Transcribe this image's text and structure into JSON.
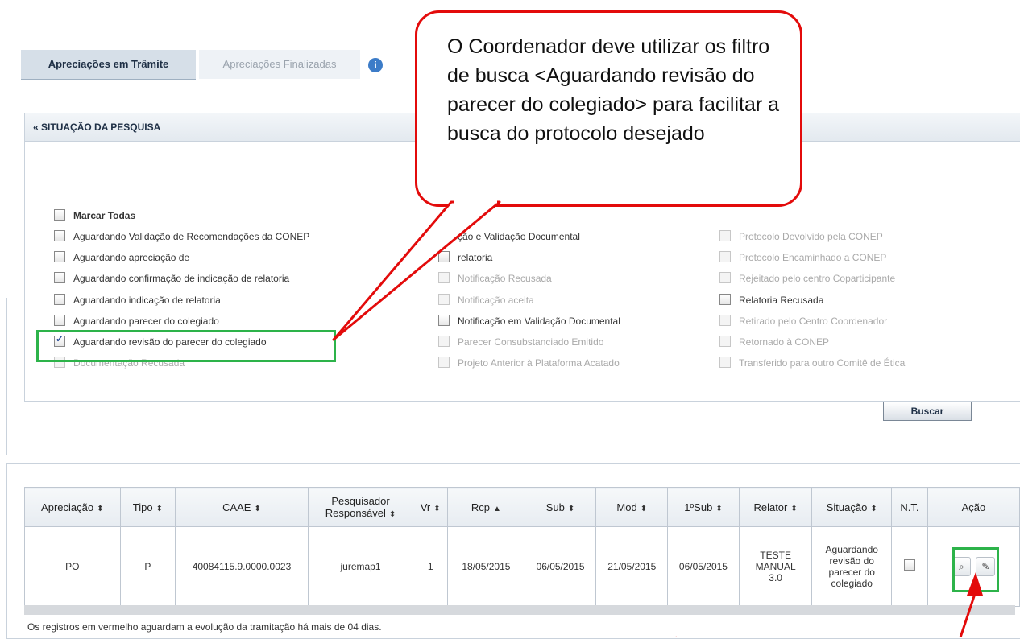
{
  "panel": {
    "toggle_icon": "«",
    "title": "SITUAÇÃO DA PESQUISA",
    "tabs": [
      {
        "label": "Apreciações em Trâmite",
        "active": true
      },
      {
        "label": "Apreciações Finalizadas",
        "active": false
      }
    ],
    "info_icon": "i",
    "buscar_label": "Buscar"
  },
  "filters": {
    "col1": [
      {
        "label": "Marcar Todas",
        "checked": false,
        "enabled": true
      },
      {
        "label": "Aguardando Validação de Recomendações da CONEP",
        "checked": false,
        "enabled": true
      },
      {
        "label": "Aguardando apreciação de",
        "checked": false,
        "enabled": true
      },
      {
        "label": "Aguardando confirmação de indicação de relatoria",
        "checked": false,
        "enabled": true
      },
      {
        "label": "Aguardando indicação de relatoria",
        "checked": false,
        "enabled": true
      },
      {
        "label": "Aguardando parecer do colegiado",
        "checked": false,
        "enabled": true
      },
      {
        "label": "Aguardando revisão do parecer do colegiado",
        "checked": true,
        "enabled": true
      },
      {
        "label": "Documentação Recusada",
        "checked": false,
        "enabled": false
      }
    ],
    "col2": [
      {
        "label": "ção e Validação Documental",
        "checked": false,
        "enabled": true
      },
      {
        "label": "relatoria",
        "checked": false,
        "enabled": true
      },
      {
        "label": "Notificação Recusada",
        "checked": false,
        "enabled": false
      },
      {
        "label": "Notificação aceita",
        "checked": false,
        "enabled": false
      },
      {
        "label": "Notificação em Validação Documental",
        "checked": false,
        "enabled": true
      },
      {
        "label": "Parecer Consubstanciado Emitido",
        "checked": false,
        "enabled": false
      },
      {
        "label": "Projeto Anterior à Plataforma Acatado",
        "checked": false,
        "enabled": false
      }
    ],
    "col3": [
      {
        "label": "Protocolo Devolvido pela CONEP",
        "checked": false,
        "enabled": false
      },
      {
        "label": "Protocolo Encaminhado a CONEP",
        "checked": false,
        "enabled": false
      },
      {
        "label": "Rejeitado pelo centro Coparticipante",
        "checked": false,
        "enabled": false
      },
      {
        "label": "Relatoria Recusada",
        "checked": false,
        "enabled": true
      },
      {
        "label": "Retirado pelo Centro Coordenador",
        "checked": false,
        "enabled": false
      },
      {
        "label": "Retornado à CONEP",
        "checked": false,
        "enabled": false
      },
      {
        "label": "Transferido para outro Comitê de Ética",
        "checked": false,
        "enabled": false
      }
    ]
  },
  "table": {
    "headers": {
      "apreciacao": "Apreciação",
      "tipo": "Tipo",
      "caae": "CAAE",
      "pesq_line1": "Pesquisador",
      "pesq_line2": "Responsável",
      "vr": "Vr",
      "rcp": "Rcp",
      "sub": "Sub",
      "mod": "Mod",
      "primeira_sub": "1ºSub",
      "relator": "Relator",
      "situacao": "Situação",
      "nt": "N.T.",
      "acao": "Ação"
    },
    "sort_icon": "⬍",
    "sort_up_icon": "▲",
    "row": {
      "apreciacao": "PO",
      "tipo": "P",
      "caae": "40084115.9.0000.0023",
      "pesquisador": "juremap1",
      "vr": "1",
      "rcp": "18/05/2015",
      "sub": "06/05/2015",
      "mod": "21/05/2015",
      "primeira_sub": "06/05/2015",
      "relator_l1": "TESTE",
      "relator_l2": "MANUAL",
      "relator_l3": "3.0",
      "sit_l1": "Aguardando",
      "sit_l2": "revisão do",
      "sit_l3": "parecer do",
      "sit_l4": "colegiado"
    },
    "view_icon": "⌕",
    "edit_icon": "✎"
  },
  "footer_note": "Os registros em vermelho aguardam a evolução da tramitação há mais de 04 dias.",
  "callout": {
    "text": "O Coordenador deve utilizar os filtro de busca <Aguardando revisão do parecer do colegiado> para facilitar a busca do protocolo desejado"
  },
  "colors": {
    "callout_border": "#e30b0b",
    "highlight_border": "#2db34a"
  }
}
